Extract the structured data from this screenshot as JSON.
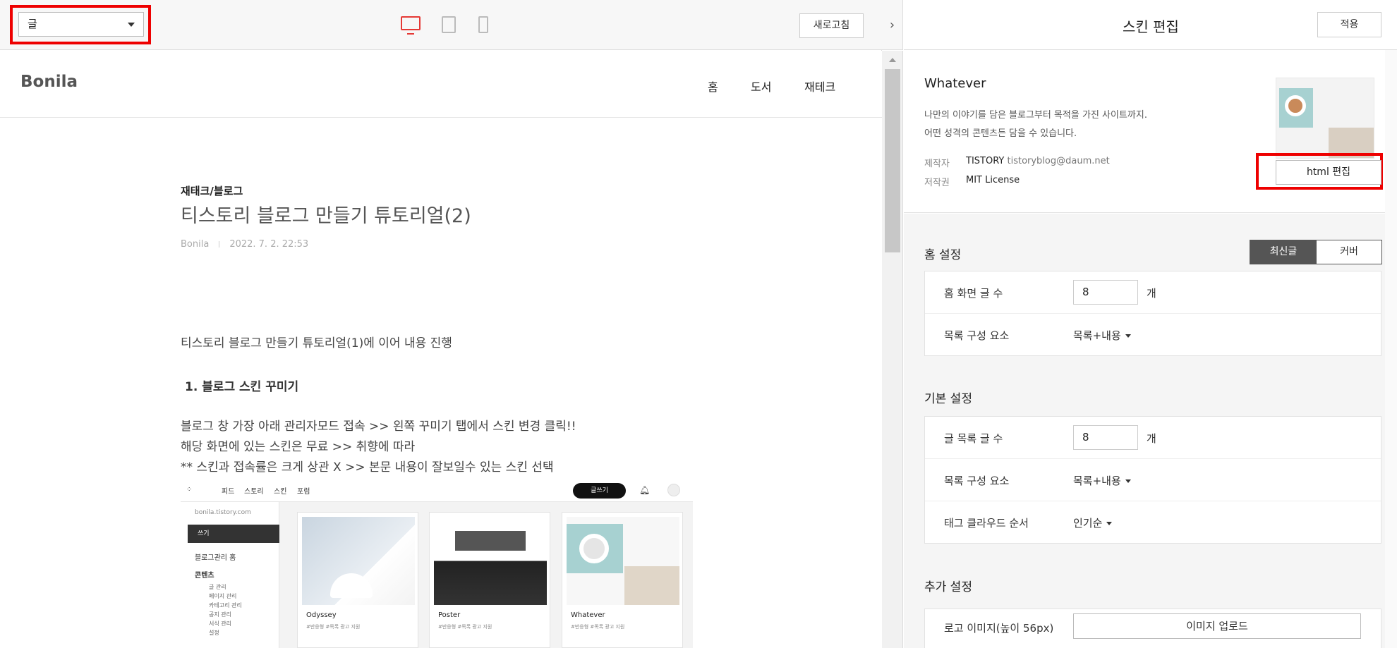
{
  "toolbar": {
    "view_select": "글",
    "refresh": "새로고침"
  },
  "blog": {
    "logo": "Bonila",
    "nav": [
      "홈",
      "도서",
      "재테크"
    ],
    "category": "재태크/블로그",
    "title": "티스토리 블로그 만들기 튜토리얼(2)",
    "author": "Bonila",
    "date": "2022. 7. 2. 22:53",
    "intro": "티스토리 블로그 만들기 튜토리얼(1)에 이어 내용 진행",
    "section_heading": "1. 블로그 스킨 꾸미기",
    "lines": [
      "블로그 창 가장 아래 관리자모드 접속 >> 왼쪽 꾸미기 탭에서 스킨 변경 클릭!!",
      "해당 화면에 있는 스킨은 무료 >> 취향에 따라",
      "** 스킨과 접속률은 크게 상관 X >> 본문 내용이 잘보일수 있는 스킨 선택"
    ]
  },
  "embedded": {
    "nav": [
      "피드",
      "스토리",
      "스킨",
      "포럼"
    ],
    "write": "글쓰기",
    "url": "bonila.tistory.com",
    "side_write": "쓰기",
    "home": "블로그관리 홈",
    "content": "콘텐츠",
    "sub_items": [
      "글 관리",
      "페이지 관리",
      "카테고리 관리",
      "공지 관리",
      "서식 관리",
      "설정"
    ],
    "cards": [
      {
        "name": "Odyssey",
        "tags": "#반응형  #목록 광고 지원"
      },
      {
        "name": "Poster",
        "tags": "#반응형  #목록 광고 지원"
      },
      {
        "name": "Whatever",
        "tags": "#반응형  #목록 광고 지원"
      }
    ]
  },
  "panel": {
    "title": "스킨 편집",
    "apply": "적용",
    "skin_name": "Whatever",
    "desc1": "나만의 이야기를 담은 블로그부터 목적을 가진 사이트까지.",
    "desc2": "어떤 성격의 콘텐츠든 담을 수 있습니다.",
    "maker_label": "제작자",
    "maker_value": "TISTORY",
    "maker_email": "tistoryblog@daum.net",
    "license_label": "저작권",
    "license_value": "MIT License",
    "html_edit": "html 편집"
  },
  "home_settings": {
    "title": "홈 설정",
    "toggle": [
      "최신글",
      "커버"
    ],
    "rows": [
      {
        "label": "홈 화면 글 수",
        "value": "8",
        "unit": "개"
      },
      {
        "label": "목록 구성 요소",
        "value": "목록+내용"
      }
    ]
  },
  "basic_settings": {
    "title": "기본 설정",
    "rows": [
      {
        "label": "글 목록 글 수",
        "value": "8",
        "unit": "개"
      },
      {
        "label": "목록 구성 요소",
        "value": "목록+내용"
      },
      {
        "label": "태그 클라우드 순서",
        "value": "인기순"
      }
    ]
  },
  "extra_settings": {
    "title": "추가 설정",
    "logo_label": "로고 이미지(높이 56px)",
    "upload": "이미지 업로드"
  },
  "colors": {
    "highlight": "#e00000",
    "active_device": "#e53935",
    "toggle_active": "#555555"
  }
}
